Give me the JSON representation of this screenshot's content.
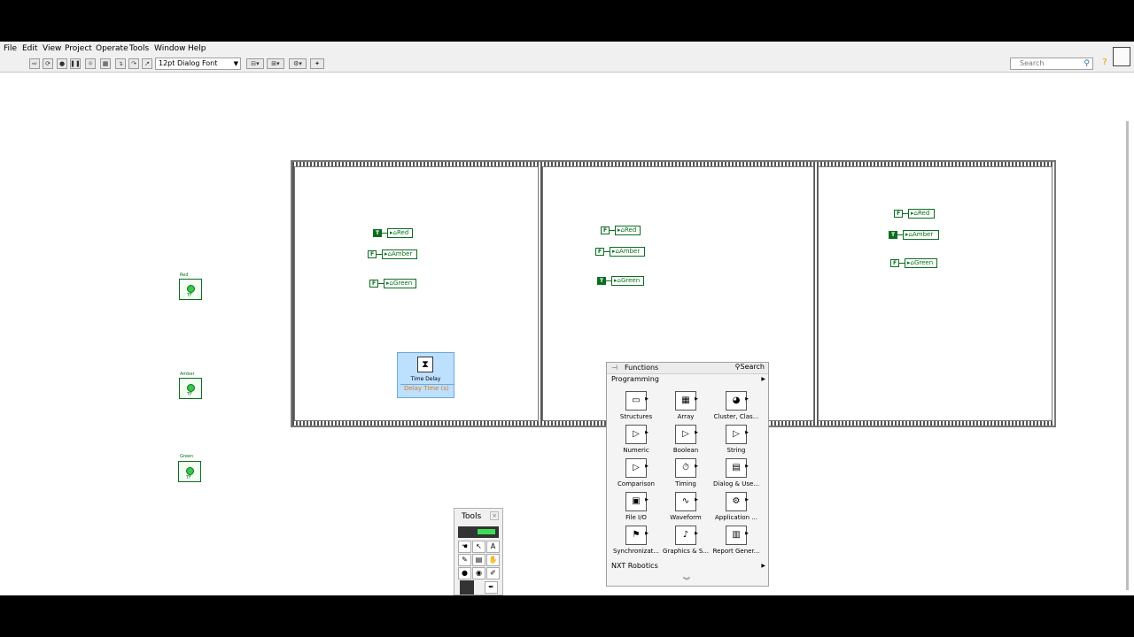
{
  "menu": [
    "File",
    "Edit",
    "View",
    "Project",
    "Operate",
    "Tools",
    "Window",
    "Help"
  ],
  "toolbar": {
    "font": "12pt Dialog Font",
    "search_placeholder": "Search"
  },
  "indicators": [
    {
      "label": "Red"
    },
    {
      "label": "Amber"
    },
    {
      "label": "Green"
    }
  ],
  "frames": [
    {
      "vars": [
        {
          "const": "T",
          "name": "Red"
        },
        {
          "const": "F",
          "name": "Amber"
        },
        {
          "const": "F",
          "name": "Green"
        }
      ]
    },
    {
      "vars": [
        {
          "const": "F",
          "name": "Red"
        },
        {
          "const": "F",
          "name": "Amber"
        },
        {
          "const": "T",
          "name": "Green"
        }
      ]
    },
    {
      "vars": [
        {
          "const": "F",
          "name": "Red"
        },
        {
          "const": "T",
          "name": "Amber"
        },
        {
          "const": "F",
          "name": "Green"
        }
      ]
    }
  ],
  "time_delay": {
    "title": "Time Delay",
    "input": "Delay Time (s)"
  },
  "functions_palette": {
    "title": "Functions",
    "search": "Search",
    "category": "Programming",
    "items": [
      "Structures",
      "Array",
      "Cluster, Clas...",
      "Numeric",
      "Boolean",
      "String",
      "Comparison",
      "Timing",
      "Dialog & Use...",
      "File I/O",
      "Waveform",
      "Application ...",
      "Synchronizat...",
      "Graphics & S...",
      "Report Gener..."
    ],
    "footer_category": "NXT Robotics"
  },
  "tools_palette": {
    "title": "Tools"
  }
}
